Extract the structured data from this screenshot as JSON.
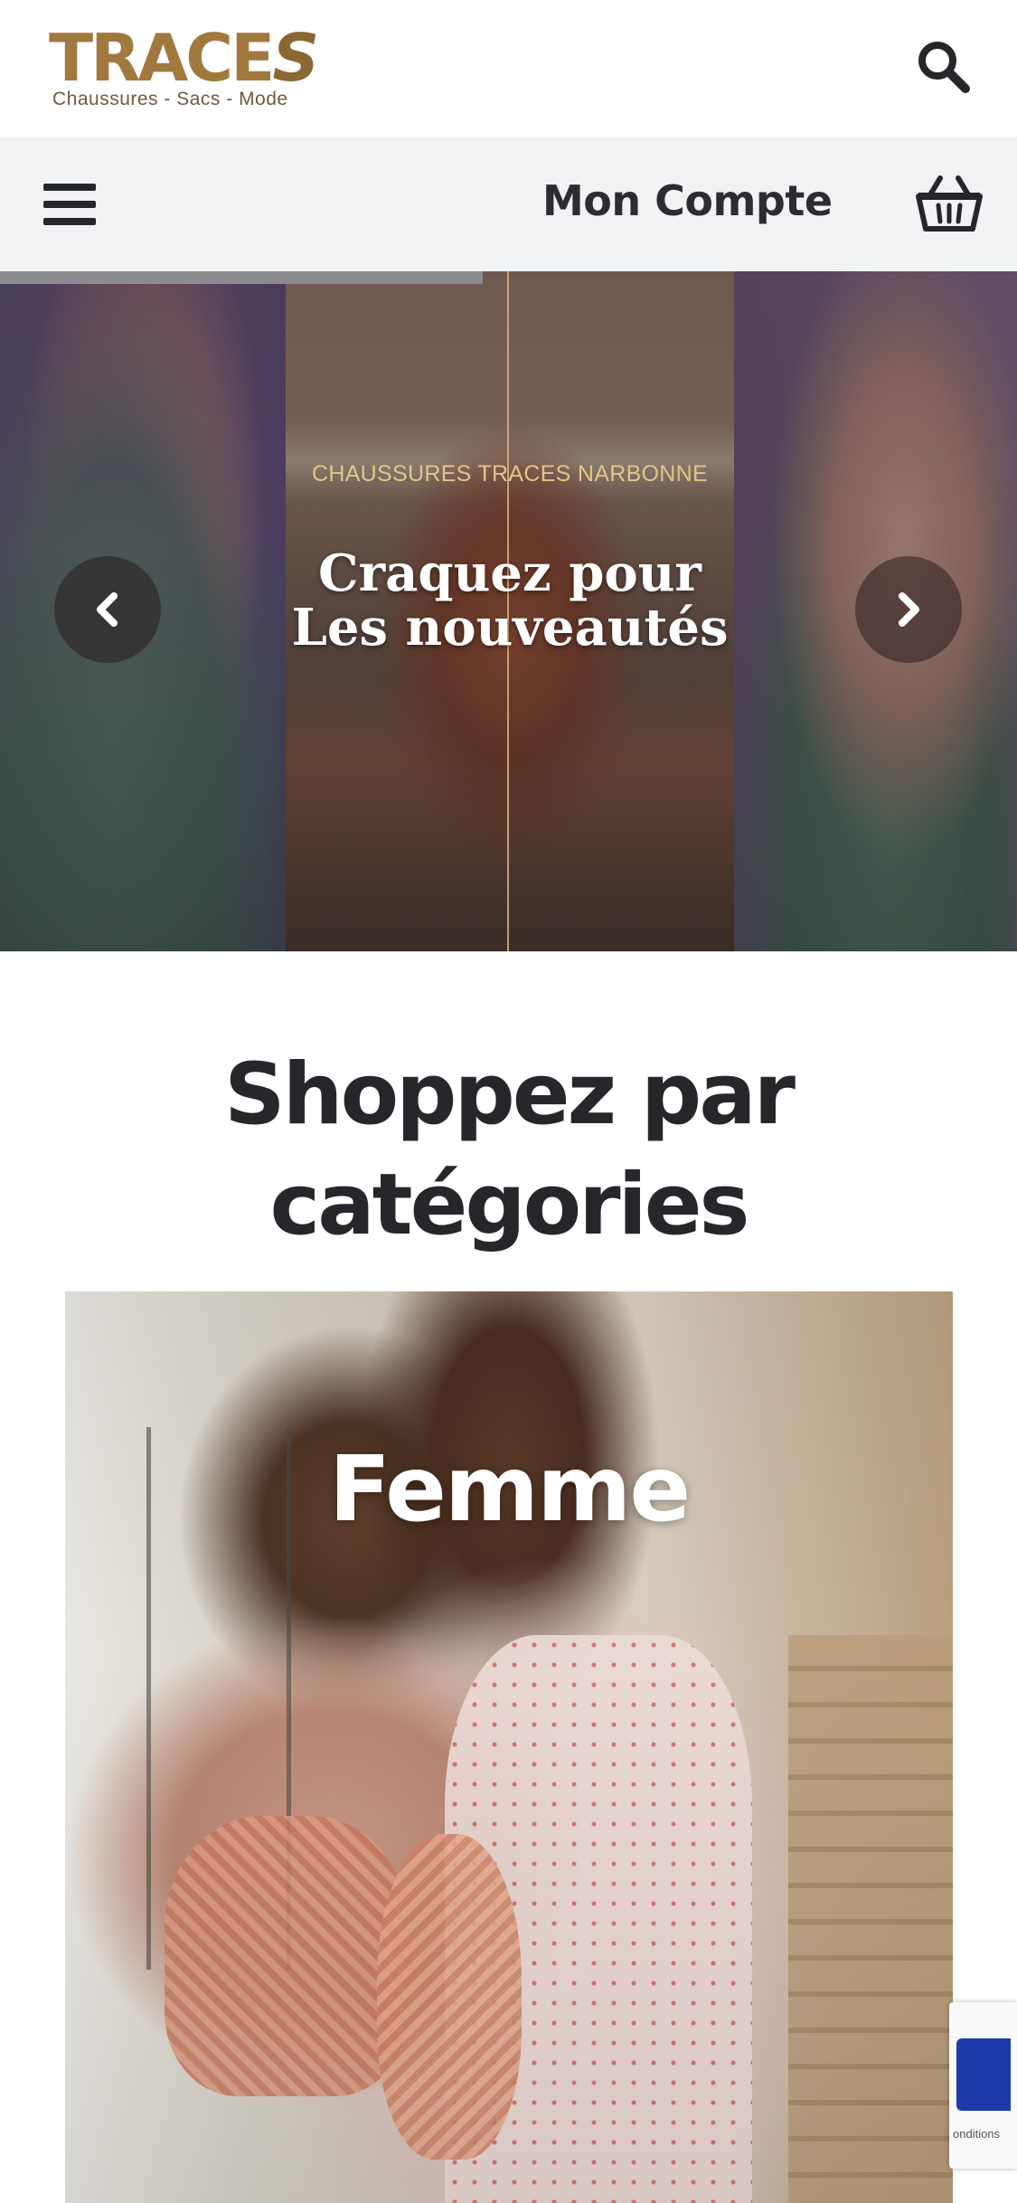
{
  "header": {
    "logo_wordmark": "TRACES",
    "logo_tagline": "Chaussures - Sacs - Mode",
    "search_icon": "search-icon"
  },
  "nav": {
    "menu_icon": "hamburger-menu-icon",
    "account_label": "Mon Compte",
    "cart_icon": "basket-icon"
  },
  "hero": {
    "kicker": "CHAUSSURES TRACES NARBONNE",
    "title_line1": "Craquez pour",
    "title_line2": "Les nouveautés",
    "prev_icon": "chevron-left-icon",
    "next_icon": "chevron-right-icon",
    "slide_progress": 0.475
  },
  "categories": {
    "title_line1": "Shoppez par",
    "title_line2": "catégories",
    "items": [
      {
        "label": "Femme"
      }
    ]
  },
  "recaptcha": {
    "text": "onditions"
  },
  "colors": {
    "brand_gold": "#a1793f",
    "navbar_bg": "#f1f2f4",
    "text_dark": "#25272b",
    "hero_kicker": "#e2c487"
  }
}
